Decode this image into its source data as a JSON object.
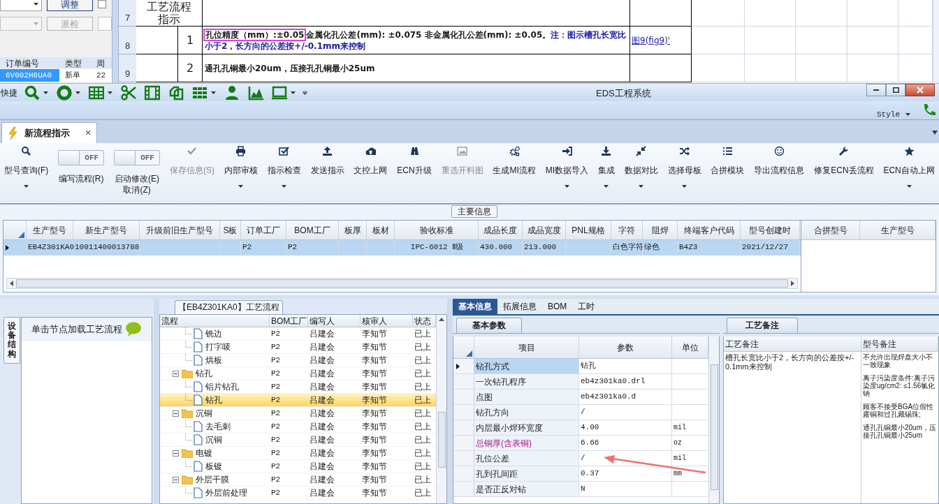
{
  "sheet_form": {
    "buttons": [
      {
        "label": "调整",
        "disabled": false
      },
      {
        "label": "派检",
        "disabled": true
      }
    ],
    "checkbox": {
      "checked": false
    },
    "order_table": {
      "columns": [
        "订单编号",
        "类型",
        "周"
      ],
      "rows": [
        {
          "cells": [
            "6V002H6UA0",
            "新单",
            "22"
          ],
          "selected": true
        }
      ]
    }
  },
  "sheet": {
    "row_numbers": [
      "7",
      "8",
      "9"
    ],
    "section_title": "工艺流程指示",
    "items": [
      {
        "number": "1",
        "highlighted": "孔位精度（mm）:±0.05",
        "text": "金属化孔公差(mm): ±0.075 非金属化孔公差(mm): ±0.05。",
        "note": "注：图示槽孔长宽比小于2，长方向的公差按+/-0.1mm来控制",
        "link": "图9(fig9)'"
      },
      {
        "number": "2",
        "text": "通孔孔铜最小20um，压接孔孔铜最小25um"
      }
    ]
  },
  "window": {
    "title": "EDS工程系统",
    "quick_access_label": "快捷",
    "style_menu": "Style"
  },
  "doc_tabs": [
    {
      "label": "新流程指示",
      "selected": true,
      "close": "×"
    }
  ],
  "ribbon": [
    {
      "kind": "button",
      "label": [
        "型号查询(F)"
      ],
      "dropdown": true,
      "disabled": false
    },
    {
      "kind": "toggle",
      "label": [
        "编写流程(R)"
      ],
      "toggle_text": "OFF",
      "on": false
    },
    {
      "kind": "toggle",
      "label": [
        "启动修改(E)",
        "取消(Z)"
      ],
      "toggle_text": "OFF",
      "on": false
    },
    {
      "kind": "button",
      "label": [
        "保存信息(S)"
      ],
      "dropdown": false,
      "disabled": true
    },
    {
      "kind": "button",
      "label": [
        "内部审核"
      ],
      "dropdown": true,
      "disabled": false
    },
    {
      "kind": "button",
      "label": [
        "指示检查"
      ],
      "dropdown": true,
      "disabled": false
    },
    {
      "kind": "button",
      "label": [
        "发送指示"
      ],
      "dropdown": false,
      "disabled": false
    },
    {
      "kind": "button",
      "label": [
        "文控上网"
      ],
      "dropdown": false,
      "disabled": false
    },
    {
      "kind": "button",
      "label": [
        "ECN升级"
      ],
      "dropdown": false,
      "disabled": false
    },
    {
      "kind": "button",
      "label": [
        "重选开料图"
      ],
      "dropdown": false,
      "disabled": true
    },
    {
      "kind": "button",
      "label": [
        "生成MI流程"
      ],
      "dropdown": false,
      "disabled": false
    },
    {
      "kind": "button",
      "label": [
        "MI数据导入"
      ],
      "dropdown": true,
      "disabled": false
    },
    {
      "kind": "button",
      "label": [
        "集成"
      ],
      "dropdown": true,
      "disabled": false
    },
    {
      "kind": "button",
      "label": [
        "数据对比"
      ],
      "dropdown": true,
      "disabled": false
    },
    {
      "kind": "button",
      "label": [
        "选择母板"
      ],
      "dropdown": true,
      "disabled": false
    },
    {
      "kind": "button",
      "label": [
        "合拼模块"
      ],
      "dropdown": false,
      "disabled": false
    },
    {
      "kind": "button",
      "label": [
        "导出流程信息"
      ],
      "dropdown": false,
      "disabled": false
    },
    {
      "kind": "button",
      "label": [
        "修复ECN丢流程"
      ],
      "dropdown": false,
      "disabled": false
    },
    {
      "kind": "button",
      "label": [
        "ECN自动上网"
      ],
      "dropdown": true,
      "disabled": false
    }
  ],
  "main_info": {
    "title": "主要信息",
    "columns": [
      "生产型号",
      "新生产型号",
      "升级前旧生产型号",
      "S板",
      "订单工厂",
      "BOM工厂",
      "板厚",
      "板材",
      "验收标准",
      "成品长度",
      "成品宽度",
      "PNL规格",
      "字符",
      "阻焊",
      "终端客户代码",
      "型号创建时"
    ],
    "rows": [
      {
        "selected": true,
        "cells": [
          "EB4Z301KA0",
          "10011400013788",
          null,
          null,
          "P2",
          "P2",
          null,
          null,
          "IPC-6012 Ⅱ级",
          "430.000",
          "213.000",
          null,
          "白色字符",
          "绿色",
          "B4Z3",
          "2021/12/27"
        ]
      }
    ],
    "merge_table": {
      "columns": [
        "合拼型号",
        "生产型号"
      ]
    }
  },
  "flow_panel": {
    "side_tab": "设备结构",
    "hint": "单击节点加载工艺流程",
    "title": "【EB4Z301KA0】工艺流程",
    "columns": [
      "流程",
      "BOM工厂",
      "编写人",
      "核审人",
      "状态"
    ],
    "nodes": [
      {
        "kind": "step",
        "name": "铣边",
        "bom": "P2",
        "writer": "吕建会",
        "reviewer": "李知节",
        "status": "已上",
        "selected": false
      },
      {
        "kind": "step",
        "name": "打字唛",
        "bom": "P2",
        "writer": "吕建会",
        "reviewer": "李知节",
        "status": "已上",
        "selected": false
      },
      {
        "kind": "step",
        "name": "烘板",
        "bom": "P2",
        "writer": "吕建会",
        "reviewer": "李知节",
        "status": "已上",
        "selected": false
      },
      {
        "kind": "group",
        "name": "钻孔",
        "bom": "P2",
        "writer": "吕建会",
        "reviewer": "李知节",
        "status": "已上",
        "selected": false,
        "expanded": true,
        "children": [
          {
            "kind": "step",
            "name": "铝片钻孔",
            "bom": "P2",
            "writer": "吕建会",
            "reviewer": "李知节",
            "status": "已上",
            "selected": false
          },
          {
            "kind": "step",
            "name": "钻孔",
            "bom": "P2",
            "writer": "吕建会",
            "reviewer": "李知节",
            "status": "已上",
            "selected": true
          }
        ]
      },
      {
        "kind": "group",
        "name": "沉铜",
        "bom": "P2",
        "writer": "吕建会",
        "reviewer": "李知节",
        "status": "已上",
        "selected": false,
        "expanded": true,
        "children": [
          {
            "kind": "step",
            "name": "去毛刺",
            "bom": "P2",
            "writer": "吕建会",
            "reviewer": "李知节",
            "status": "已上",
            "selected": false
          },
          {
            "kind": "step",
            "name": "沉铜",
            "bom": "P2",
            "writer": "吕建会",
            "reviewer": "李知节",
            "status": "已上",
            "selected": false
          }
        ]
      },
      {
        "kind": "group",
        "name": "电镀",
        "bom": "P2",
        "writer": "吕建会",
        "reviewer": "李知节",
        "status": "已上",
        "selected": false,
        "expanded": true,
        "children": [
          {
            "kind": "step",
            "name": "板镀",
            "bom": "P2",
            "writer": "吕建会",
            "reviewer": "李知节",
            "status": "已上",
            "selected": false
          }
        ]
      },
      {
        "kind": "group",
        "name": "外层干膜",
        "bom": "P2",
        "writer": "吕建会",
        "reviewer": "李知节",
        "status": "已上",
        "selected": false,
        "expanded": true,
        "children": [
          {
            "kind": "step",
            "name": "外层前处理",
            "bom": "P2",
            "writer": "吕建会",
            "reviewer": "李知节",
            "status": "已上",
            "selected": false
          }
        ]
      }
    ]
  },
  "info_tabs": [
    {
      "label": "基本信息",
      "selected": true
    },
    {
      "label": "拓展信息",
      "selected": false
    },
    {
      "label": "BOM",
      "selected": false
    },
    {
      "label": "工时",
      "selected": false
    }
  ],
  "basic_params": {
    "title": "基本参数",
    "columns": [
      "项目",
      "参数",
      "单位"
    ],
    "rows": [
      {
        "item": "钻孔方式",
        "value": "钻孔",
        "selected": true,
        "flagged": false
      },
      {
        "item": "一次钻孔程序",
        "value": "eb4z301ka0.drl",
        "selected": false,
        "flagged": false
      },
      {
        "item": "点图",
        "value": "eb4z301ka0.d",
        "selected": false,
        "flagged": false
      },
      {
        "item": "钻孔方向",
        "value": "/",
        "selected": false,
        "flagged": false
      },
      {
        "item": "内层最小焊环宽度",
        "value": "4.00",
        "unit": "mil",
        "selected": false,
        "flagged": false
      },
      {
        "item": "总铜厚(含表铜)",
        "value": "6.66",
        "unit": "oz",
        "selected": false,
        "flagged": true
      },
      {
        "item": "孔位公差",
        "value": "/",
        "unit": "mil",
        "selected": false,
        "flagged": false
      },
      {
        "item": "孔到孔间距",
        "value": "0.37",
        "unit": "mm",
        "selected": false,
        "flagged": false
      },
      {
        "item": "是否正反对钻",
        "value": "N",
        "selected": false,
        "flagged": false
      }
    ]
  },
  "remarks": {
    "title": "工艺备注",
    "columns": [
      "工艺备注",
      "型号备注"
    ],
    "process_note": "槽孔长宽比小于2，长方向的公差按+/-0.1mm来控制",
    "model_note": [
      "不允许出现焊盘大小不一致现象",
      "离子污染度条件:离子污染度ug/cm2: ≤1.56氯化钠",
      "顾客不接受BGA位假性露铜和过孔藏锡珠;",
      "通孔孔铜最小20um，压接孔孔铜最小25um"
    ]
  }
}
